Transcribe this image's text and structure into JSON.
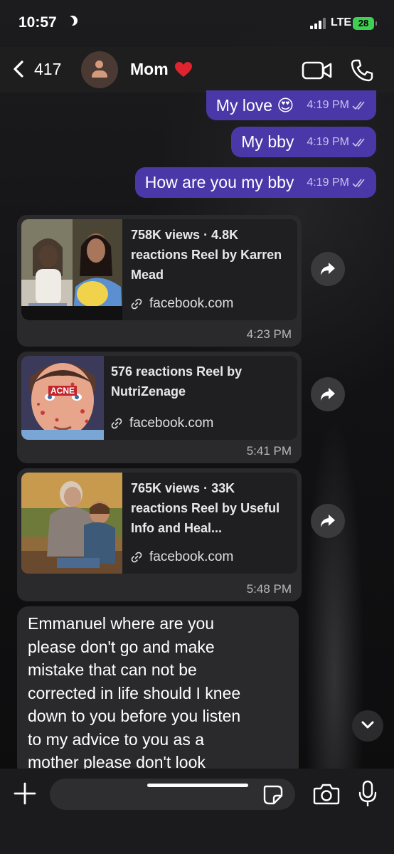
{
  "status_bar": {
    "time": "10:57",
    "network": "LTE",
    "battery": "28"
  },
  "header": {
    "back_count": "417",
    "contact_name": "Mom"
  },
  "outgoing_messages": [
    {
      "text": "My love 😍",
      "time": "4:19 PM"
    },
    {
      "text": "My bby",
      "time": "4:19 PM"
    },
    {
      "text": "How are you my bby",
      "time": "4:19 PM"
    }
  ],
  "shared_reels": [
    {
      "title": "758K views · 4.8K reactions Reel by Karren Mead",
      "link": "facebook.com",
      "time": "4:23 PM"
    },
    {
      "title": "576 reactions Reel by NutriZenage",
      "thumb_label": "ACNE",
      "link": "facebook.com",
      "time": "5:41 PM"
    },
    {
      "title": "765K views · 33K reactions Reel by Useful Info and Heal...",
      "link": "facebook.com",
      "time": "5:48 PM"
    }
  ],
  "incoming_message": {
    "text": "Emmanuel  where are you\nplease  don't go  and make\nmistake  that  can not  be\ncorrected  in life  should  I knee\ndown  to you  before you  listen\nto  my advice  to  you as a\nmother  please  don't look"
  },
  "composer": {
    "placeholder": ""
  },
  "colors": {
    "outgoing_bubble": "#4b38a8",
    "incoming_bubble": "#2a2a2c",
    "battery": "#3ecf53"
  },
  "icons": [
    "back-chevron-icon",
    "person-icon",
    "heart-icon",
    "video-call-icon",
    "phone-icon",
    "double-check-icon",
    "link-icon",
    "share-arrow-icon",
    "chevron-down-icon",
    "plus-icon",
    "sticker-icon",
    "camera-icon",
    "microphone-icon",
    "moon-icon"
  ]
}
